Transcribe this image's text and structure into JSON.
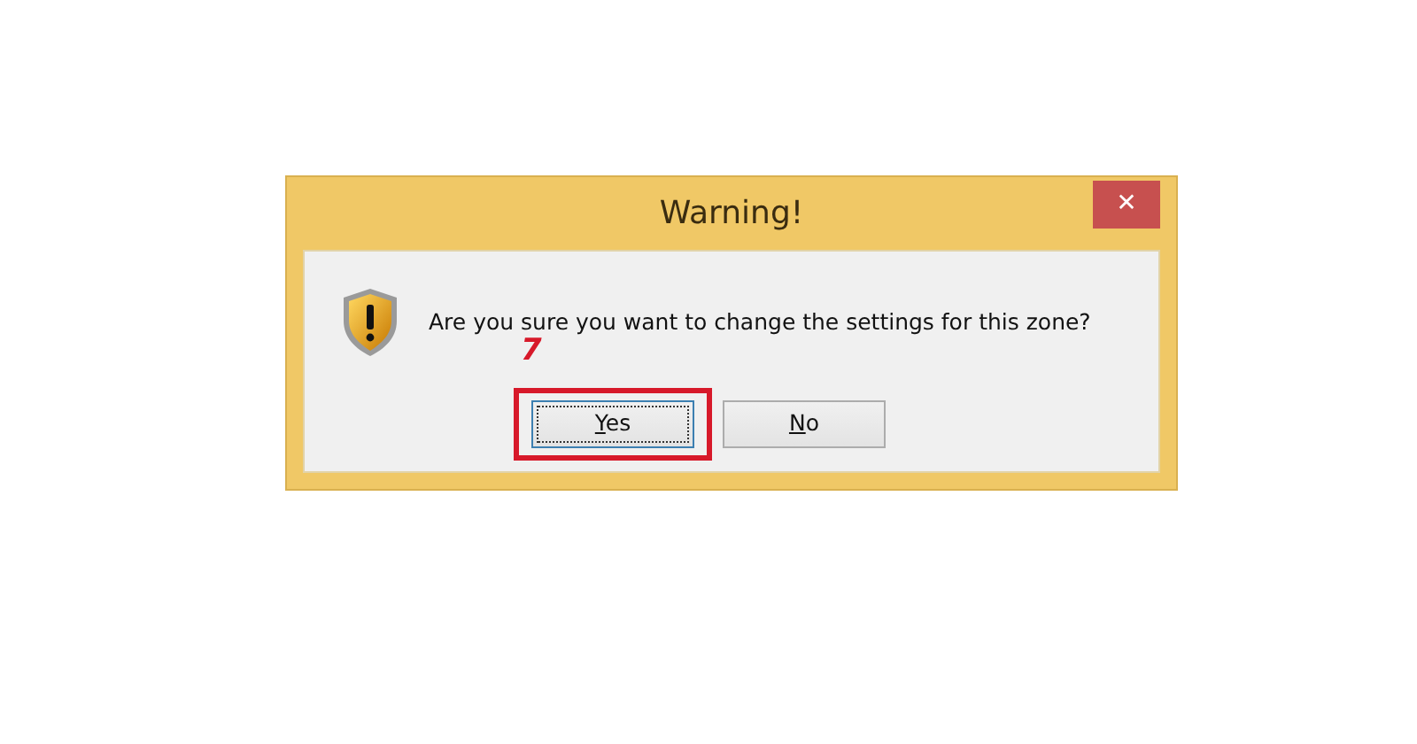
{
  "window": {
    "title": "Warning!",
    "close": "✕"
  },
  "message": "Are you sure you want to change the settings for this zone?",
  "annotation": {
    "label": "7"
  },
  "buttons": [
    {
      "label": "Yes",
      "underline_first": true,
      "focused": true,
      "highlighted": true
    },
    {
      "label": "No",
      "underline_first": true,
      "focused": false,
      "highlighted": false
    }
  ]
}
